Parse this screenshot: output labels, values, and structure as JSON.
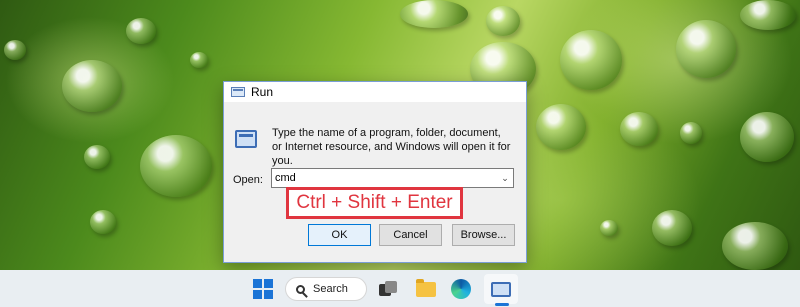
{
  "wallpaper": {
    "description_colors": {
      "leaf_green": "#86b832",
      "dark_green": "#2f5a12"
    }
  },
  "run_dialog": {
    "title": "Run",
    "description": "Type the name of a program, folder, document, or Internet resource, and Windows will open it for you.",
    "open_label": "Open:",
    "open_value": "cmd",
    "ok_label": "OK",
    "cancel_label": "Cancel",
    "browse_label": "Browse..."
  },
  "callout": {
    "text": "Ctrl + Shift + Enter",
    "color": "#e0353f"
  },
  "taskbar": {
    "search_label": "Search",
    "icons": [
      "windows-start-icon",
      "search-icon",
      "task-view-icon",
      "file-explorer-icon",
      "edge-icon",
      "run-app-icon"
    ],
    "accent": "#1b74d6"
  }
}
